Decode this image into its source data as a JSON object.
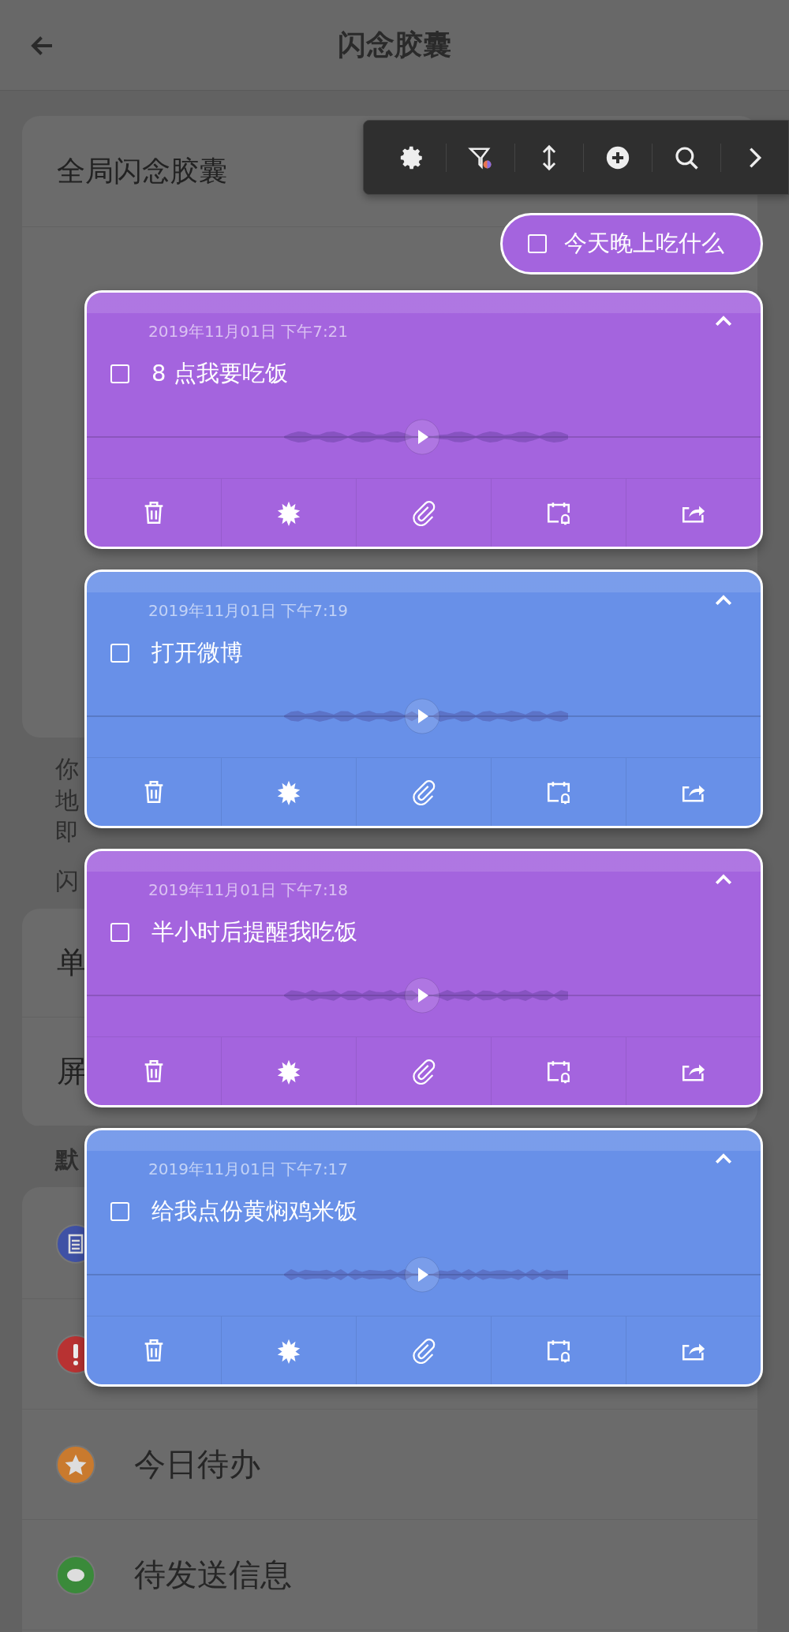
{
  "header": {
    "title": "闪念胶囊"
  },
  "background": {
    "card_title": "全局闪念胶囊",
    "description_lines": [
      "你",
      "地",
      "即"
    ],
    "section_label": "闪",
    "settings_rows": [
      "单",
      "屏"
    ],
    "list_label": "默",
    "list_items": [
      {
        "kind": "document",
        "color": "#3f51a5"
      },
      {
        "kind": "alert",
        "color": "#b83232"
      },
      {
        "kind": "star",
        "color": "#c97a2e",
        "label": "今日待办"
      },
      {
        "kind": "message",
        "color": "#3a8a3a",
        "label": "待发送信息"
      }
    ]
  },
  "quick_note": {
    "text": "今天晚上吃什么",
    "checked": false
  },
  "notes": [
    {
      "date": "2019年11月01日 下午7:21",
      "text": "8 点我要吃饭",
      "checked": false,
      "color": "#a464de"
    },
    {
      "date": "2019年11月01日 下午7:19",
      "text": "打开微博",
      "checked": false,
      "color": "#6890e8"
    },
    {
      "date": "2019年11月01日 下午7:18",
      "text": "半小时后提醒我吃饭",
      "checked": false,
      "color": "#a464de"
    },
    {
      "date": "2019年11月01日 下午7:17",
      "text": "给我点份黄焖鸡米饭",
      "checked": false,
      "color": "#6890e8"
    }
  ]
}
